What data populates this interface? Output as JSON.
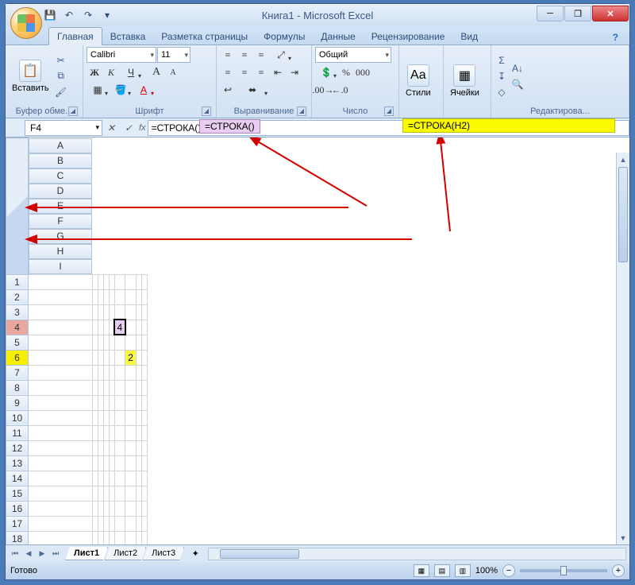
{
  "title": "Книга1 - Microsoft Excel",
  "qat": {
    "save": "💾",
    "undo": "↶",
    "redo": "↷",
    "dd": "▾"
  },
  "tabs": {
    "items": [
      "Главная",
      "Вставка",
      "Разметка страницы",
      "Формулы",
      "Данные",
      "Рецензирование",
      "Вид"
    ],
    "active_index": 0
  },
  "ribbon": {
    "clipboard": {
      "paste": "Вставить",
      "label": "Буфер обме..."
    },
    "font": {
      "name": "Calibri",
      "size": "11",
      "bold": "Ж",
      "italic": "К",
      "underline": "Ч",
      "grow": "А",
      "shrink": "А",
      "label": "Шрифт"
    },
    "align": {
      "label": "Выравнивание"
    },
    "number": {
      "format": "Общий",
      "label": "Число"
    },
    "styles": {
      "label": "Стили"
    },
    "cells": {
      "label": "Ячейки"
    },
    "editing": {
      "label": "Редактирова..."
    }
  },
  "formula_bar": {
    "namebox": "F4",
    "fx": "fx",
    "formula": "=СТРОКА()"
  },
  "annotation": {
    "formula1": "=СТРОКА()",
    "formula2": "=СТРОКА(H2)"
  },
  "columns": [
    "A",
    "B",
    "C",
    "D",
    "E",
    "F",
    "G",
    "H",
    "I"
  ],
  "rows": [
    1,
    2,
    3,
    4,
    5,
    6,
    7,
    8,
    9,
    10,
    11,
    12,
    13,
    14,
    15,
    16,
    17,
    18
  ],
  "cells": {
    "F4": "4",
    "G6": "2"
  },
  "sheets": {
    "items": [
      "Лист1",
      "Лист2",
      "Лист3"
    ],
    "active_index": 0
  },
  "status": {
    "ready": "Готово",
    "zoom": "100%"
  }
}
